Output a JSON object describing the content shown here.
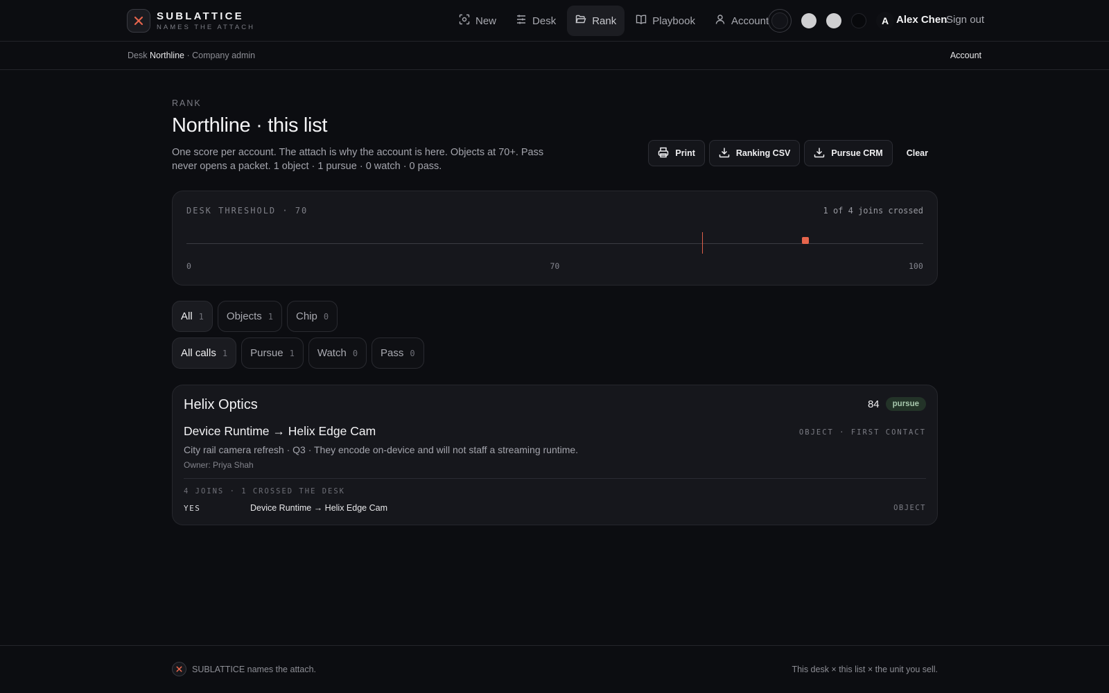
{
  "brand": {
    "name": "SUBLATTICE",
    "tagline": "NAMES THE ATTACH",
    "accent_color": "#e6654c"
  },
  "nav": {
    "items": [
      {
        "label": "New",
        "icon": "scan-icon"
      },
      {
        "label": "Desk",
        "icon": "sliders-icon"
      },
      {
        "label": "Rank",
        "icon": "folder-open-icon",
        "active": true
      },
      {
        "label": "Playbook",
        "icon": "book-icon"
      },
      {
        "label": "Account",
        "icon": "user-icon"
      }
    ],
    "avatar_initial": "A",
    "user_name": "Alex Chen",
    "sign_out": "Sign out"
  },
  "breadcrumb": {
    "desk": "Desk",
    "company": "Northline",
    "role": "· Company admin",
    "account_link": "Account"
  },
  "page": {
    "eyebrow": "RANK",
    "title": "Northline · this list",
    "description": "One score per account. The attach is why the account is here. Objects at 70+. Pass never opens a packet. 1 object · 1 pursue · 0 watch · 0 pass."
  },
  "actions": {
    "print": "Print",
    "ranking_csv": "Ranking CSV",
    "pursue_crm": "Pursue CRM",
    "clear": "Clear"
  },
  "threshold": {
    "label": "DESK THRESHOLD · 70",
    "status": "1 of 4 joins crossed",
    "min": 0,
    "max": 100,
    "threshold_value": 70,
    "score_value": 84,
    "tick_min": "0",
    "tick_mid": "70",
    "tick_max": "100"
  },
  "filters": {
    "type": [
      {
        "label": "All",
        "count": "1",
        "active": true
      },
      {
        "label": "Objects",
        "count": "1"
      },
      {
        "label": "Chip",
        "count": "0"
      }
    ],
    "call": [
      {
        "label": "All calls",
        "count": "1",
        "active": true
      },
      {
        "label": "Pursue",
        "count": "1"
      },
      {
        "label": "Watch",
        "count": "0"
      },
      {
        "label": "Pass",
        "count": "0"
      }
    ]
  },
  "card": {
    "account": "Helix Optics",
    "score": "84",
    "call": "pursue",
    "join_title": "Device Runtime → Helix Edge Cam",
    "join_kind": "OBJECT · FIRST CONTACT",
    "join_desc": "City rail camera refresh · Q3 · They encode on-device and will not staff a streaming runtime.",
    "owner": "Owner: Priya Shah",
    "joins_label": "4 JOINS · 1 CROSSED THE DESK",
    "rows": [
      {
        "status": "YES",
        "name": "Device Runtime → Helix Edge Cam",
        "kind": "OBJECT"
      }
    ]
  },
  "footer": {
    "left": "SUBLATTICE names the attach.",
    "right": "This desk × this list × the unit you sell."
  }
}
